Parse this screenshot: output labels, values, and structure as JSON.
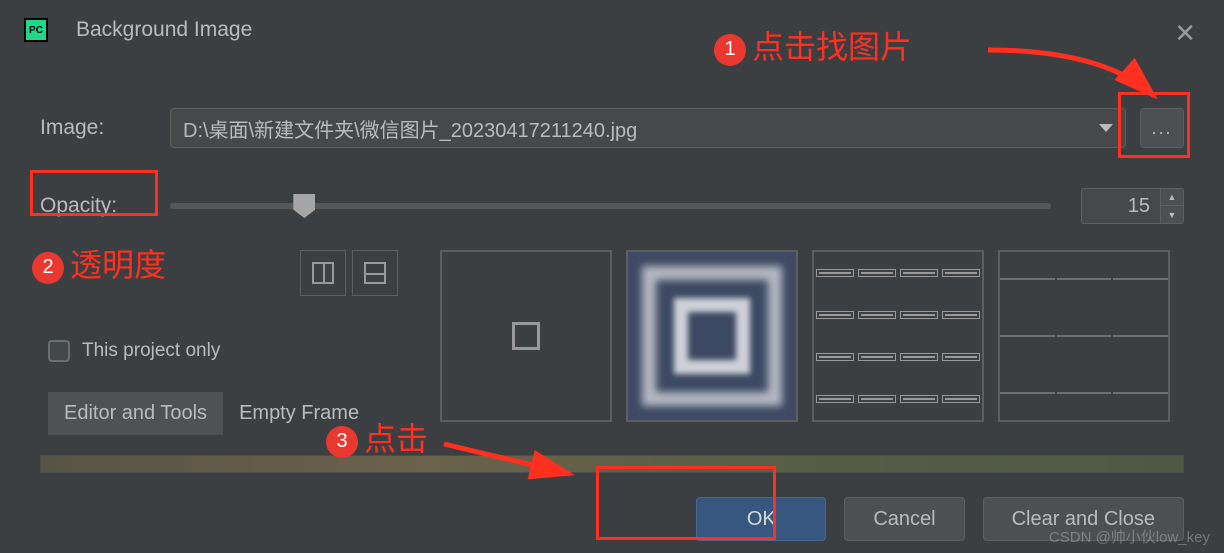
{
  "window": {
    "title": "Background Image",
    "app_badge": "PC"
  },
  "fields": {
    "image_label": "Image:",
    "image_value": "D:\\桌面\\新建文件夹\\微信图片_20230417211240.jpg",
    "browse": "...",
    "opacity_label": "Opacity:",
    "opacity_value": "15",
    "project_only": "This project only"
  },
  "tabs": {
    "editor": "Editor and Tools",
    "empty": "Empty Frame"
  },
  "buttons": {
    "ok": "OK",
    "cancel": "Cancel",
    "clear": "Clear and Close"
  },
  "annotations": {
    "a1": "点击找图片",
    "a2": "透明度",
    "a3": "点击"
  },
  "watermark": "CSDN @帅小伙low_key"
}
